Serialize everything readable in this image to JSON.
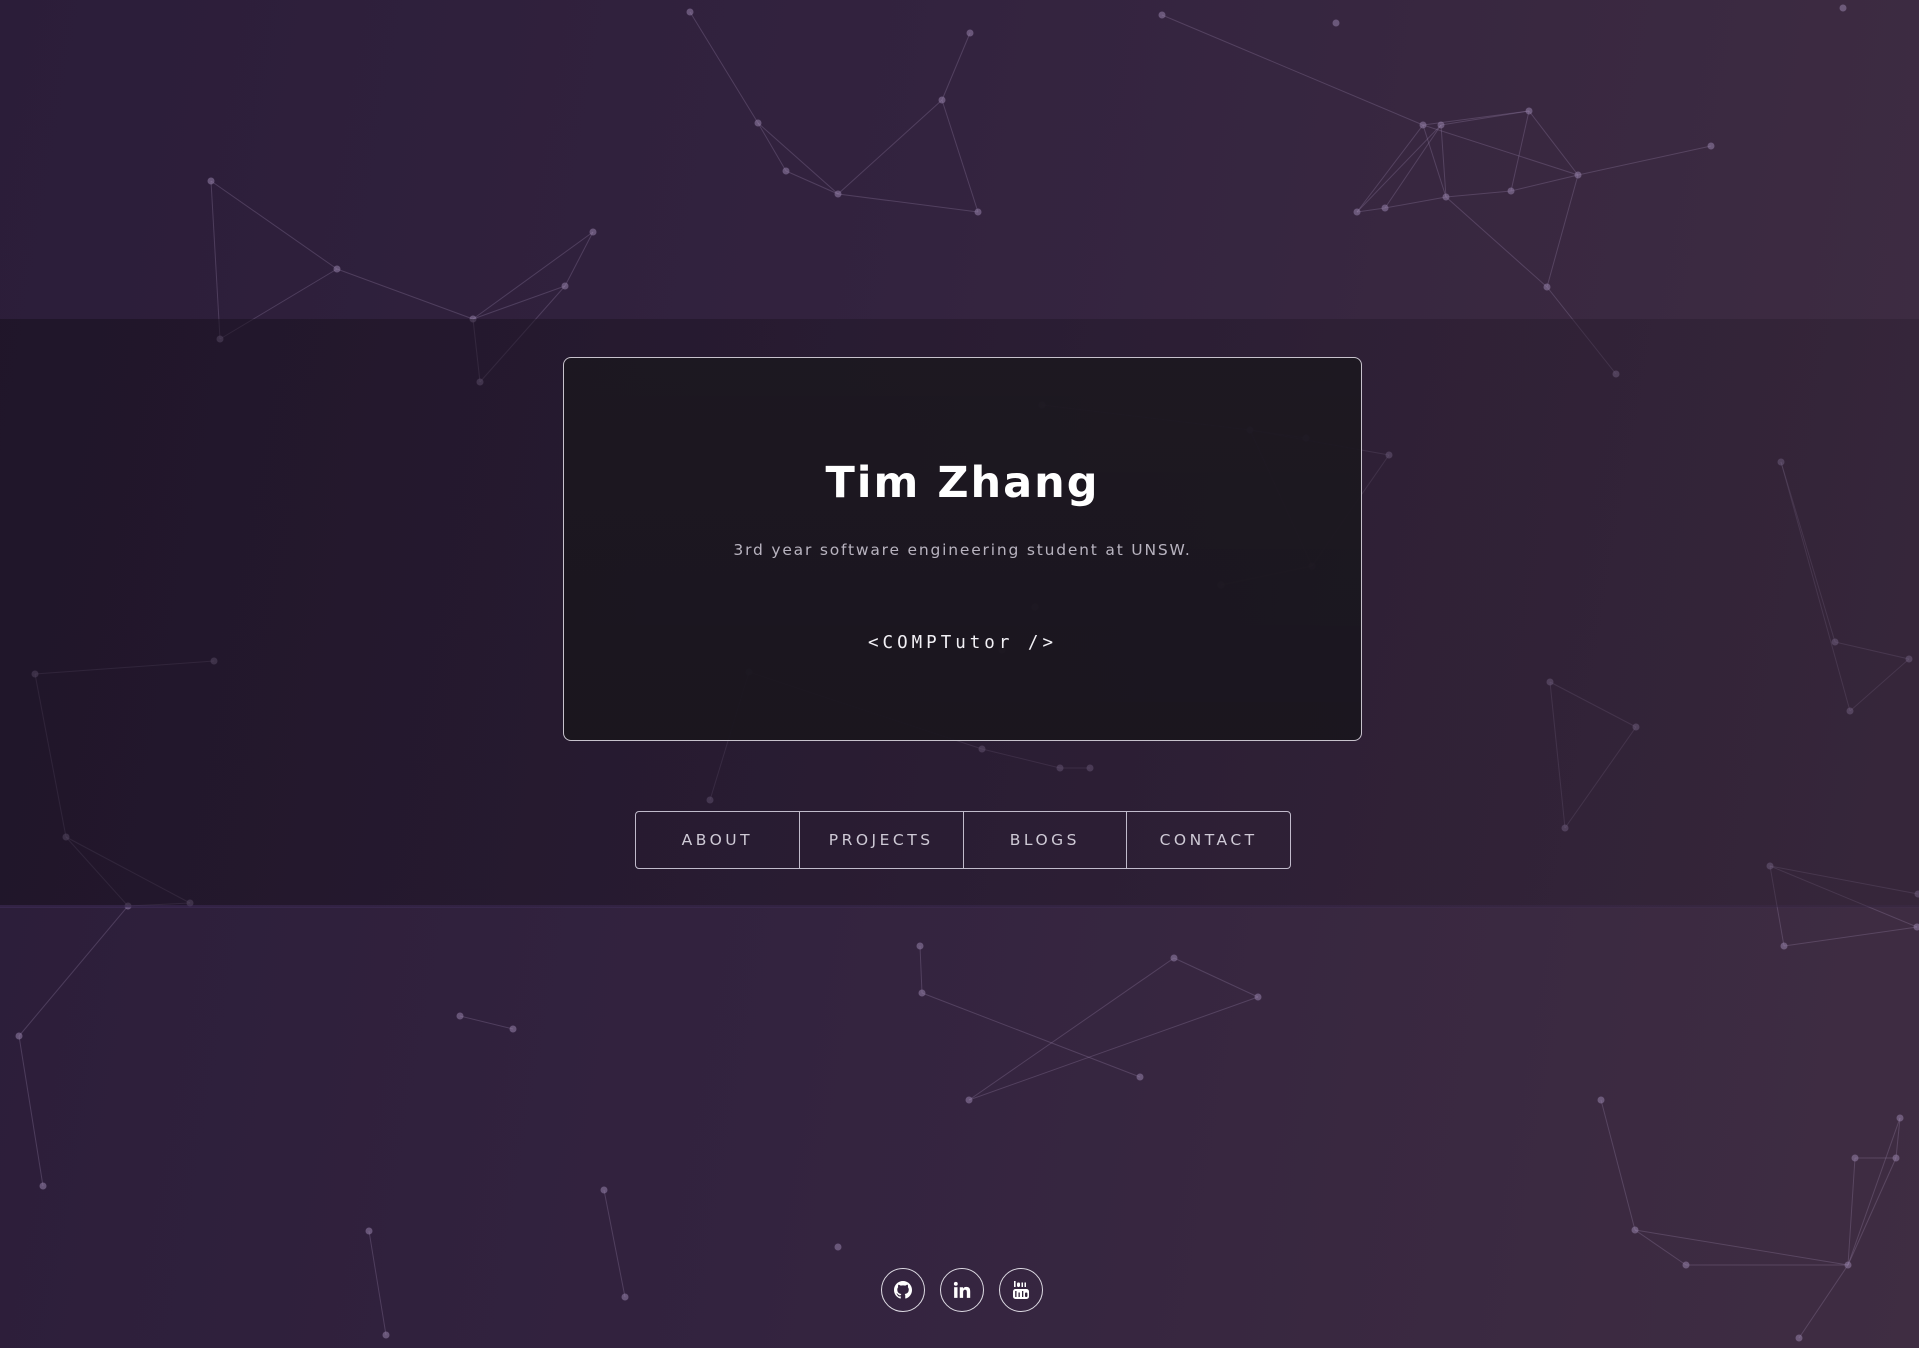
{
  "hero": {
    "name": "Tim Zhang",
    "tagline": "3rd year software engineering student at UNSW.",
    "link_label": "<COMPTutor />"
  },
  "nav": {
    "items": [
      {
        "label": "ABOUT"
      },
      {
        "label": "PROJECTS"
      },
      {
        "label": "BLOGS"
      },
      {
        "label": "CONTACT"
      }
    ]
  },
  "social": [
    {
      "icon": "github-icon"
    },
    {
      "icon": "linkedin-icon"
    },
    {
      "icon": "youtube-icon"
    }
  ],
  "colors": {
    "background_start": "#2b1d39",
    "background_end": "#3f2d42",
    "card_background": "#1c1820",
    "accent_text": "#ffffff",
    "muted_text": "#b8b3bf"
  }
}
